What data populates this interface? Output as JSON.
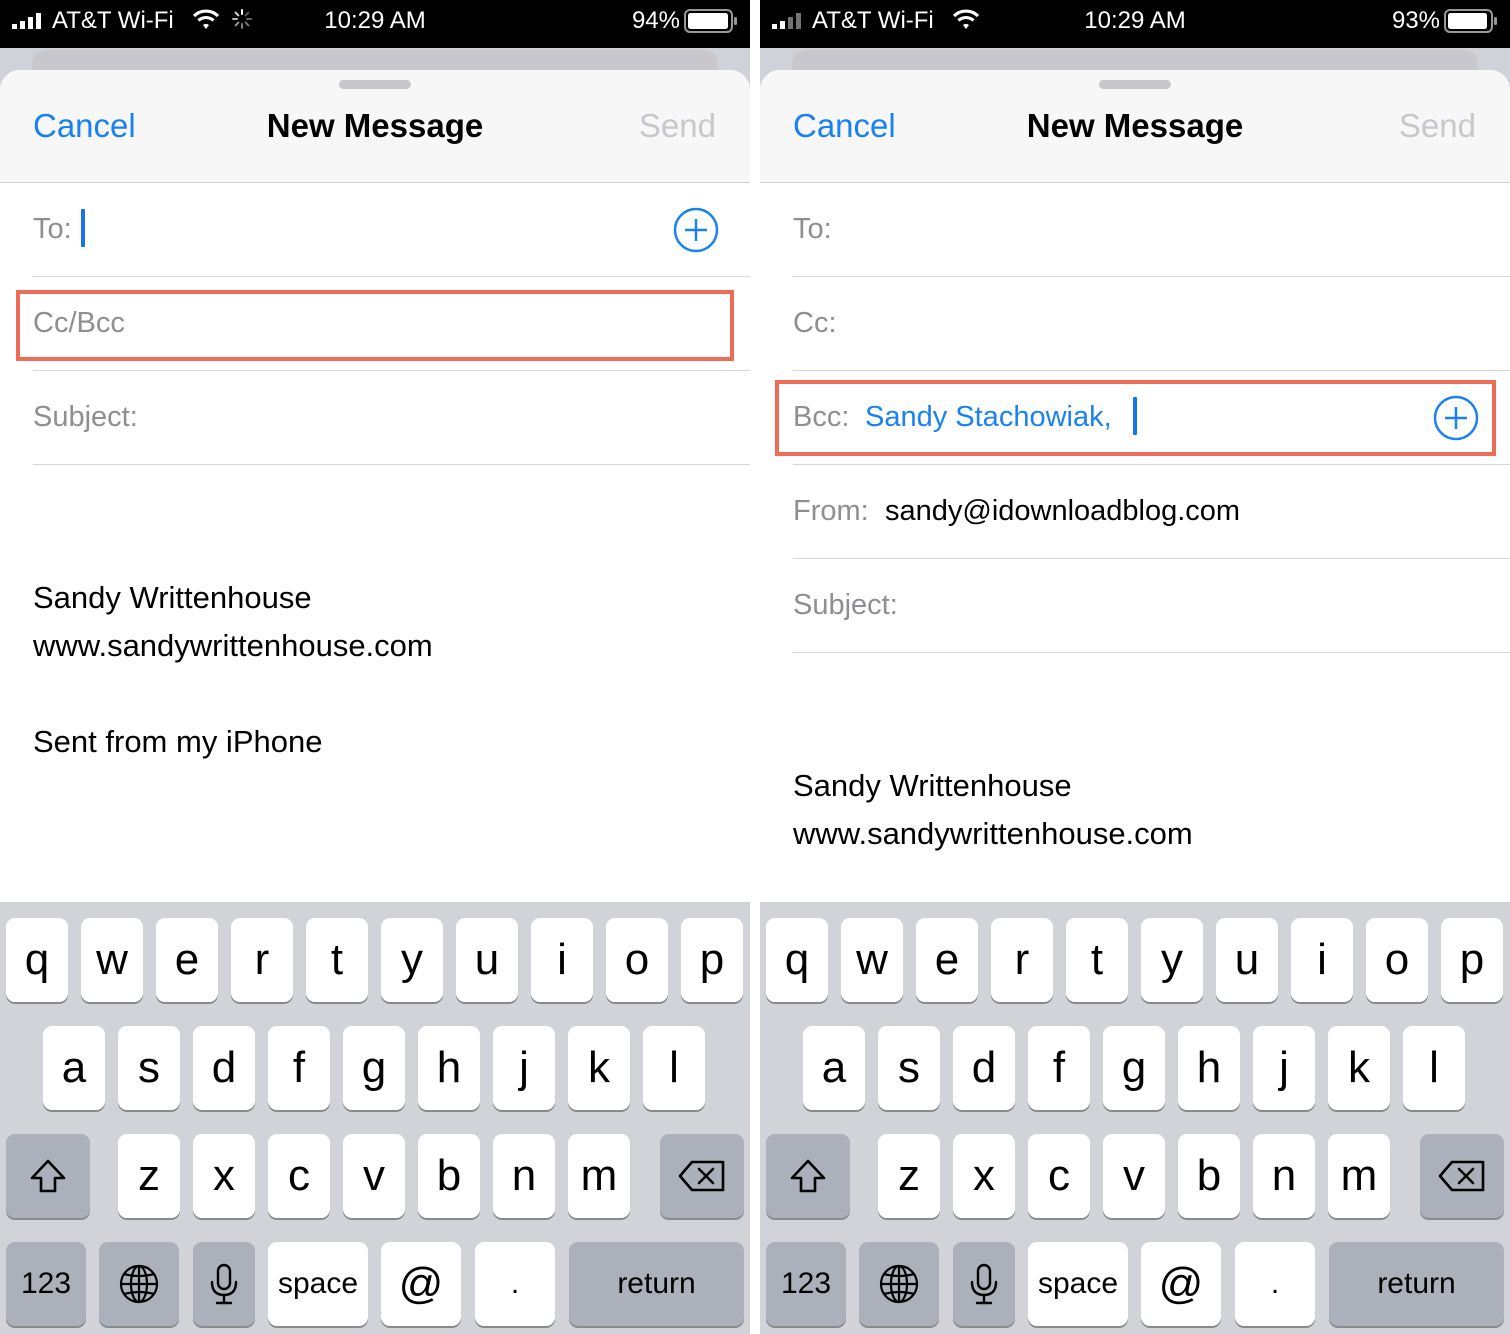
{
  "screens": [
    {
      "status": {
        "carrier": "AT&T Wi-Fi",
        "time": "10:29 AM",
        "battery": "94%"
      },
      "nav": {
        "cancel": "Cancel",
        "title": "New Message",
        "send": "Send"
      },
      "fields": {
        "to_label": "To:",
        "ccbcc_label": "Cc/Bcc",
        "subject_label": "Subject:"
      },
      "body": {
        "name": "Sandy Writtenhouse",
        "website": "www.sandywrittenhouse.com",
        "signature": "Sent from my iPhone"
      }
    },
    {
      "status": {
        "carrier": "AT&T Wi-Fi",
        "time": "10:29 AM",
        "battery": "93%"
      },
      "nav": {
        "cancel": "Cancel",
        "title": "New Message",
        "send": "Send"
      },
      "fields": {
        "to_label": "To:",
        "cc_label": "Cc:",
        "bcc_label": "Bcc:",
        "bcc_recipient": "Sandy Stachowiak,",
        "from_label": "From:",
        "from_value": "sandy@idownloadblog.com",
        "subject_label": "Subject:"
      },
      "body": {
        "name": "Sandy Writtenhouse",
        "website": "www.sandywrittenhouse.com"
      }
    }
  ],
  "keyboard": {
    "row1": [
      "q",
      "w",
      "e",
      "r",
      "t",
      "y",
      "u",
      "i",
      "o",
      "p"
    ],
    "row2": [
      "a",
      "s",
      "d",
      "f",
      "g",
      "h",
      "j",
      "k",
      "l"
    ],
    "row3": [
      "z",
      "x",
      "c",
      "v",
      "b",
      "n",
      "m"
    ],
    "numbers_label": "123",
    "space_label": "space",
    "at_label": "@",
    "period_label": ".",
    "return_label": "return",
    "icons": {
      "shift": "shift-icon",
      "delete": "delete-icon",
      "globe": "globe-icon",
      "mic": "microphone-icon"
    }
  },
  "colors": {
    "accent": "#1a82f0",
    "highlight": "#ee6b55",
    "keyboard_bg": "#d1d3d9",
    "dark_key": "#abb0bb"
  }
}
